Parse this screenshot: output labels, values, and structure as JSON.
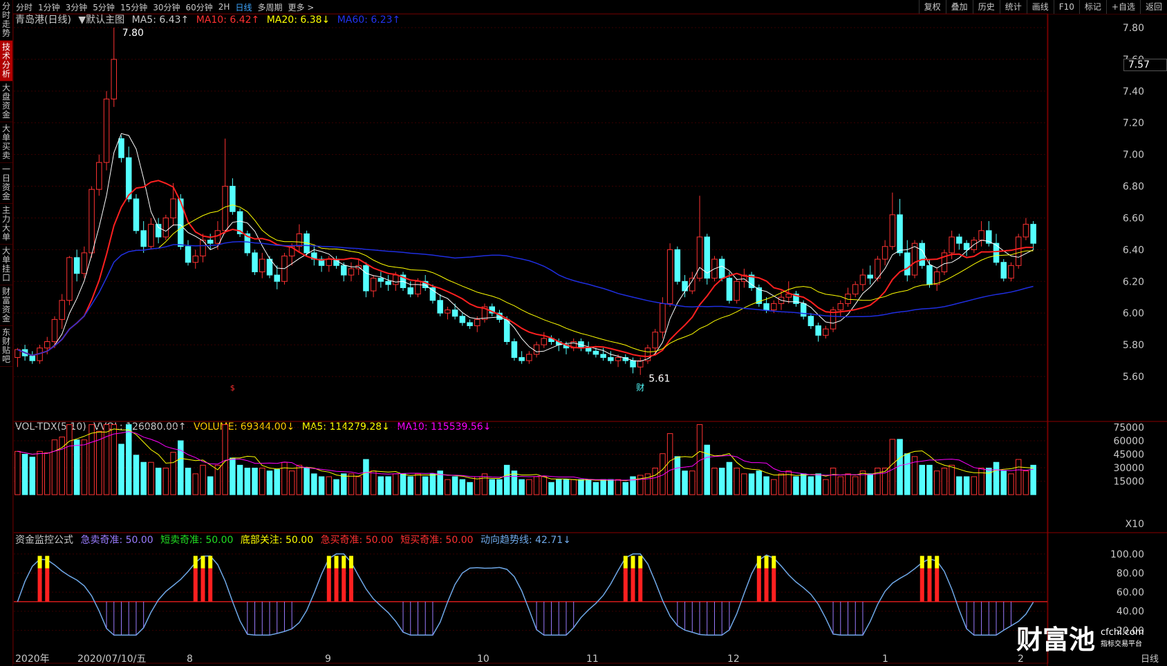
{
  "left_tabs": [
    "分时走势",
    "技术分析",
    "大盘资金",
    "大单买卖",
    "一日资金",
    "主力大单",
    "大单挂口",
    "财富资金",
    "东财贴吧"
  ],
  "periods": [
    "分时",
    "1分钟",
    "3分钟",
    "5分钟",
    "15分钟",
    "30分钟",
    "60分钟",
    "2H",
    "日线",
    "多周期",
    "更多 >"
  ],
  "active_period": "日线",
  "toolbar_right": [
    "复权",
    "叠加",
    "历史",
    "统计",
    "画线",
    "F10",
    "标记",
    "+自选",
    "返回"
  ],
  "main_legend": {
    "stock": "青岛港(日线)",
    "chart_mode": "▼默认主图",
    "ma5": "MA5: 6.43↑",
    "ma10": "MA10: 6.42↑",
    "ma20": "MA20: 6.38↓",
    "ma60": "MA60: 6.23↑"
  },
  "vol_legend": {
    "name": "VOL-TDX(5,10)",
    "vvol": "VVOL: 126080.00↑",
    "volume": "VOLUME: 69344.00↓",
    "ma5": "MA5: 114279.28↓",
    "ma10": "MA10: 115539.56↓"
  },
  "ind_legend": {
    "name": "资金监控公式",
    "a": "急卖奇准: 50.00",
    "b": "短卖奇准: 50.00",
    "c": "底部关注: 50.00",
    "d": "急买奇准: 50.00",
    "e": "短买奇准: 50.00",
    "f": "动向趋势线: 42.71↓"
  },
  "price_axis": [
    "7.80",
    "7.60",
    "7.40",
    "7.20",
    "7.00",
    "6.80",
    "6.60",
    "6.40",
    "6.20",
    "6.00",
    "5.80",
    "5.60"
  ],
  "current_price": "7.57",
  "vol_axis": [
    "75000",
    "60000",
    "45000",
    "30000",
    "15000"
  ],
  "vol_unit": "X10",
  "ind_axis": [
    "100.00",
    "80.00",
    "60.00",
    "40.00",
    "20.00"
  ],
  "x_axis": [
    "2020年",
    "2020/07/10/五",
    "8",
    "9",
    "10",
    "11",
    "12",
    "1",
    "2"
  ],
  "high_label": "7.80",
  "low_label": "5.61",
  "event_s": "$",
  "event_cai": "财",
  "bottom_right": "日线",
  "watermark_cn": "财富池",
  "watermark_url": "cfchi.com",
  "watermark_sub": "指标交易平台",
  "colors": {
    "up": "#ff3232",
    "down": "#54ffff",
    "ma5": "#ffffff",
    "ma10": "#ff2020",
    "ma20": "#ffff00",
    "ma60": "#1f2ee0",
    "vol_ma5": "#ffff00",
    "vol_ma10": "#ff00ff",
    "trend": "#6fa8e8",
    "grid": "#3a0000"
  },
  "chart_data": {
    "type": "candlestick",
    "ohlc": [
      [
        5.72,
        5.78,
        5.66,
        5.77
      ],
      [
        5.77,
        5.8,
        5.7,
        5.73
      ],
      [
        5.73,
        5.76,
        5.68,
        5.7
      ],
      [
        5.7,
        5.8,
        5.68,
        5.78
      ],
      [
        5.78,
        5.85,
        5.74,
        5.82
      ],
      [
        5.82,
        5.98,
        5.78,
        5.96
      ],
      [
        5.96,
        6.12,
        5.9,
        6.08
      ],
      [
        6.08,
        6.36,
        6.05,
        6.35
      ],
      [
        6.35,
        6.4,
        6.2,
        6.25
      ],
      [
        6.25,
        6.42,
        6.22,
        6.38
      ],
      [
        6.38,
        6.8,
        6.35,
        6.78
      ],
      [
        6.78,
        7.0,
        6.74,
        6.95
      ],
      [
        6.95,
        7.4,
        6.9,
        7.35
      ],
      [
        7.35,
        7.8,
        7.3,
        7.6
      ],
      [
        7.1,
        7.12,
        6.95,
        6.98
      ],
      [
        6.98,
        7.05,
        6.7,
        6.72
      ],
      [
        6.72,
        6.75,
        6.5,
        6.52
      ],
      [
        6.52,
        6.58,
        6.38,
        6.42
      ],
      [
        6.42,
        6.6,
        6.4,
        6.56
      ],
      [
        6.56,
        6.6,
        6.44,
        6.48
      ],
      [
        6.48,
        6.62,
        6.46,
        6.6
      ],
      [
        6.6,
        6.82,
        6.55,
        6.72
      ],
      [
        6.72,
        6.75,
        6.4,
        6.42
      ],
      [
        6.42,
        6.46,
        6.3,
        6.32
      ],
      [
        6.32,
        6.4,
        6.28,
        6.36
      ],
      [
        6.36,
        6.5,
        6.32,
        6.46
      ],
      [
        6.46,
        6.5,
        6.4,
        6.44
      ],
      [
        6.44,
        6.58,
        6.4,
        6.52
      ],
      [
        6.52,
        7.1,
        6.5,
        6.8
      ],
      [
        6.8,
        6.85,
        6.62,
        6.64
      ],
      [
        6.64,
        6.66,
        6.48,
        6.5
      ],
      [
        6.5,
        6.52,
        6.36,
        6.38
      ],
      [
        6.38,
        6.4,
        6.24,
        6.26
      ],
      [
        6.26,
        6.38,
        6.22,
        6.34
      ],
      [
        6.34,
        6.36,
        6.22,
        6.24
      ],
      [
        6.24,
        6.3,
        6.15,
        6.2
      ],
      [
        6.2,
        6.38,
        6.18,
        6.36
      ],
      [
        6.36,
        6.44,
        6.3,
        6.42
      ],
      [
        6.42,
        6.56,
        6.38,
        6.5
      ],
      [
        6.5,
        6.52,
        6.36,
        6.38
      ],
      [
        6.38,
        6.42,
        6.3,
        6.34
      ],
      [
        6.34,
        6.36,
        6.26,
        6.3
      ],
      [
        6.3,
        6.36,
        6.26,
        6.34
      ],
      [
        6.34,
        6.36,
        6.28,
        6.3
      ],
      [
        6.3,
        6.32,
        6.2,
        6.24
      ],
      [
        6.24,
        6.32,
        6.2,
        6.28
      ],
      [
        6.28,
        6.34,
        6.24,
        6.3
      ],
      [
        6.3,
        6.32,
        6.1,
        6.14
      ],
      [
        6.14,
        6.24,
        6.1,
        6.22
      ],
      [
        6.22,
        6.26,
        6.16,
        6.2
      ],
      [
        6.2,
        6.24,
        6.14,
        6.18
      ],
      [
        6.18,
        6.26,
        6.14,
        6.24
      ],
      [
        6.24,
        6.26,
        6.14,
        6.16
      ],
      [
        6.16,
        6.2,
        6.1,
        6.12
      ],
      [
        6.12,
        6.22,
        6.1,
        6.2
      ],
      [
        6.2,
        6.24,
        6.14,
        6.16
      ],
      [
        6.16,
        6.18,
        6.06,
        6.08
      ],
      [
        6.08,
        6.12,
        5.98,
        6.0
      ],
      [
        6.0,
        6.04,
        5.96,
        6.02
      ],
      [
        6.02,
        6.06,
        5.96,
        5.98
      ],
      [
        5.98,
        6.0,
        5.92,
        5.94
      ],
      [
        5.94,
        5.96,
        5.9,
        5.92
      ],
      [
        5.92,
        5.98,
        5.88,
        5.96
      ],
      [
        5.96,
        6.06,
        5.94,
        6.04
      ],
      [
        6.04,
        6.06,
        5.98,
        6.0
      ],
      [
        6.0,
        6.02,
        5.94,
        5.96
      ],
      [
        5.96,
        5.98,
        5.8,
        5.82
      ],
      [
        5.82,
        5.84,
        5.7,
        5.72
      ],
      [
        5.72,
        5.76,
        5.68,
        5.7
      ],
      [
        5.7,
        5.76,
        5.68,
        5.74
      ],
      [
        5.74,
        5.82,
        5.72,
        5.8
      ],
      [
        5.8,
        5.88,
        5.78,
        5.84
      ],
      [
        5.84,
        5.86,
        5.8,
        5.82
      ],
      [
        5.82,
        5.84,
        5.76,
        5.8
      ],
      [
        5.8,
        5.82,
        5.74,
        5.78
      ],
      [
        5.78,
        5.84,
        5.76,
        5.82
      ],
      [
        5.82,
        5.84,
        5.76,
        5.78
      ],
      [
        5.78,
        5.82,
        5.74,
        5.76
      ],
      [
        5.76,
        5.78,
        5.72,
        5.74
      ],
      [
        5.74,
        5.78,
        5.7,
        5.72
      ],
      [
        5.72,
        5.76,
        5.68,
        5.7
      ],
      [
        5.7,
        5.74,
        5.66,
        5.72
      ],
      [
        5.72,
        5.74,
        5.68,
        5.7
      ],
      [
        5.7,
        5.72,
        5.62,
        5.66
      ],
      [
        5.66,
        5.72,
        5.61,
        5.7
      ],
      [
        5.7,
        5.8,
        5.68,
        5.78
      ],
      [
        5.78,
        5.9,
        5.74,
        5.88
      ],
      [
        5.88,
        6.1,
        5.84,
        6.06
      ],
      [
        6.06,
        6.44,
        6.04,
        6.4
      ],
      [
        6.4,
        6.42,
        6.18,
        6.2
      ],
      [
        6.2,
        6.24,
        6.1,
        6.14
      ],
      [
        6.14,
        6.26,
        6.12,
        6.22
      ],
      [
        6.22,
        6.74,
        6.2,
        6.48
      ],
      [
        6.48,
        6.5,
        6.18,
        6.22
      ],
      [
        6.22,
        6.36,
        6.2,
        6.34
      ],
      [
        6.34,
        6.36,
        6.2,
        6.22
      ],
      [
        6.22,
        6.26,
        6.06,
        6.08
      ],
      [
        6.08,
        6.22,
        6.06,
        6.2
      ],
      [
        6.2,
        6.28,
        6.16,
        6.24
      ],
      [
        6.24,
        6.26,
        6.14,
        6.16
      ],
      [
        6.16,
        6.18,
        6.04,
        6.06
      ],
      [
        6.06,
        6.1,
        6.0,
        6.02
      ],
      [
        6.02,
        6.08,
        6.0,
        6.06
      ],
      [
        6.06,
        6.14,
        6.02,
        6.1
      ],
      [
        6.1,
        6.2,
        6.06,
        6.12
      ],
      [
        6.12,
        6.14,
        6.04,
        6.06
      ],
      [
        6.06,
        6.08,
        5.96,
        5.98
      ],
      [
        5.98,
        6.0,
        5.9,
        5.92
      ],
      [
        5.92,
        5.94,
        5.82,
        5.86
      ],
      [
        5.86,
        5.92,
        5.84,
        5.9
      ],
      [
        5.9,
        6.04,
        5.88,
        6.02
      ],
      [
        6.02,
        6.08,
        5.98,
        6.06
      ],
      [
        6.06,
        6.16,
        6.04,
        6.12
      ],
      [
        6.12,
        6.2,
        6.1,
        6.18
      ],
      [
        6.18,
        6.28,
        6.14,
        6.24
      ],
      [
        6.24,
        6.3,
        6.18,
        6.22
      ],
      [
        6.22,
        6.36,
        6.2,
        6.34
      ],
      [
        6.34,
        6.46,
        6.3,
        6.42
      ],
      [
        6.42,
        6.76,
        6.4,
        6.62
      ],
      [
        6.62,
        6.72,
        6.36,
        6.38
      ],
      [
        6.38,
        6.46,
        6.2,
        6.24
      ],
      [
        6.24,
        6.46,
        6.22,
        6.44
      ],
      [
        6.44,
        6.46,
        6.28,
        6.3
      ],
      [
        6.3,
        6.34,
        6.16,
        6.18
      ],
      [
        6.18,
        6.28,
        6.14,
        6.26
      ],
      [
        6.26,
        6.4,
        6.24,
        6.38
      ],
      [
        6.38,
        6.52,
        6.34,
        6.48
      ],
      [
        6.48,
        6.5,
        6.4,
        6.44
      ],
      [
        6.44,
        6.46,
        6.36,
        6.4
      ],
      [
        6.4,
        6.48,
        6.38,
        6.46
      ],
      [
        6.46,
        6.58,
        6.42,
        6.52
      ],
      [
        6.52,
        6.58,
        6.42,
        6.44
      ],
      [
        6.44,
        6.5,
        6.3,
        6.32
      ],
      [
        6.32,
        6.34,
        6.2,
        6.22
      ],
      [
        6.22,
        6.32,
        6.2,
        6.3
      ],
      [
        6.3,
        6.5,
        6.28,
        6.48
      ],
      [
        6.48,
        6.6,
        6.46,
        6.56
      ],
      [
        6.56,
        6.58,
        6.4,
        6.44
      ]
    ]
  }
}
